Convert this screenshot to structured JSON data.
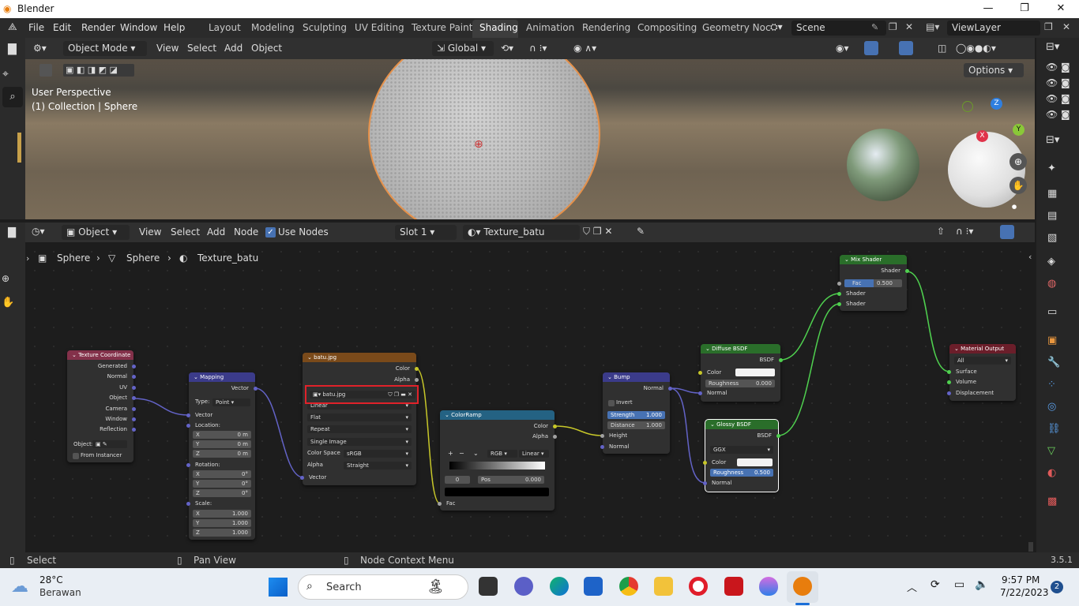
{
  "window": {
    "title": "Blender",
    "min": "—",
    "max": "❐",
    "close": "✕"
  },
  "menu": {
    "items": [
      "File",
      "Edit",
      "Render",
      "Window",
      "Help"
    ]
  },
  "workspaces": [
    "Layout",
    "Modeling",
    "Sculpting",
    "UV Editing",
    "Texture Paint",
    "Shading",
    "Animation",
    "Rendering",
    "Compositing",
    "Geometry Noc"
  ],
  "active_workspace": "Shading",
  "scene": {
    "name": "Scene",
    "view_layer": "ViewLayer"
  },
  "viewport_header": {
    "mode": "Object Mode",
    "view": "View",
    "select": "Select",
    "add": "Add",
    "object": "Object",
    "orientation": "Global",
    "options": "Options"
  },
  "viewport": {
    "perspective": "User Perspective",
    "collection": "(1) Collection | Sphere",
    "gizmo_x": "X",
    "gizmo_y": "Y",
    "gizmo_z": "Z"
  },
  "node_header": {
    "editor_type": "Object",
    "view": "View",
    "select": "Select",
    "add": "Add",
    "node": "Node",
    "use_nodes": "Use Nodes",
    "slot": "Slot 1",
    "material": "Texture_batu"
  },
  "breadcrumb": {
    "object": "Sphere",
    "mesh": "Sphere",
    "material": "Texture_batu"
  },
  "nodes": {
    "texcoord": {
      "title": "Texture Coordinate",
      "outputs": [
        "Generated",
        "Normal",
        "UV",
        "Object",
        "Camera",
        "Window",
        "Reflection"
      ],
      "object_label": "Object:",
      "from_instancer": "From Instancer"
    },
    "mapping": {
      "title": "Mapping",
      "vector_out": "Vector",
      "type_label": "Type:",
      "type_value": "Point",
      "vector_in": "Vector",
      "location": "Location:",
      "rotation": "Rotation:",
      "scale": "Scale:",
      "loc": [
        {
          "axis": "X",
          "value": "0 m"
        },
        {
          "axis": "Y",
          "value": "0 m"
        },
        {
          "axis": "Z",
          "value": "0 m"
        }
      ],
      "rot": [
        {
          "axis": "X",
          "value": "0°"
        },
        {
          "axis": "Y",
          "value": "0°"
        },
        {
          "axis": "Z",
          "value": "0°"
        }
      ],
      "scl": [
        {
          "axis": "X",
          "value": "1.000"
        },
        {
          "axis": "Y",
          "value": "1.000"
        },
        {
          "axis": "Z",
          "value": "1.000"
        }
      ]
    },
    "image": {
      "title": "batu.jpg",
      "color": "Color",
      "alpha": "Alpha",
      "image_name": "batu.jpg",
      "interp": "Linear",
      "proj": "Flat",
      "ext": "Repeat",
      "source": "Single Image",
      "cs_label": "Color Space",
      "cs_value": "sRGB",
      "alpha_label": "Alpha",
      "alpha_value": "Straight",
      "vector": "Vector"
    },
    "colorramp": {
      "title": "ColorRamp",
      "color": "Color",
      "alpha": "Alpha",
      "mode": "RGB",
      "interp": "Linear",
      "index": "0",
      "pos_label": "Pos",
      "pos_value": "0.000",
      "fac": "Fac",
      "plus": "+",
      "minus": "−"
    },
    "bump": {
      "title": "Bump",
      "normal_out": "Normal",
      "invert": "Invert",
      "strength_label": "Strength",
      "strength": "1.000",
      "distance_label": "Distance",
      "distance": "1.000",
      "height": "Height",
      "normal_in": "Normal"
    },
    "diffuse": {
      "title": "Diffuse BSDF",
      "bsdf": "BSDF",
      "color": "Color",
      "roughness_label": "Roughness",
      "roughness": "0.000",
      "normal": "Normal"
    },
    "glossy": {
      "title": "Glossy BSDF",
      "bsdf": "BSDF",
      "dist": "GGX",
      "color": "Color",
      "roughness_label": "Roughness",
      "roughness": "0.500",
      "normal": "Normal"
    },
    "mix": {
      "title": "Mix Shader",
      "shader_out": "Shader",
      "fac_label": "Fac",
      "fac": "0.500",
      "shader1": "Shader",
      "shader2": "Shader"
    },
    "output": {
      "title": "Material Output",
      "target": "All",
      "surface": "Surface",
      "volume": "Volume",
      "displacement": "Displacement"
    }
  },
  "status": {
    "select": "Select",
    "pan": "Pan View",
    "context": "Node Context Menu",
    "version": "3.5.1"
  },
  "taskbar": {
    "temp": "28°C",
    "weather": "Berawan",
    "search": "Search",
    "time": "9:57 PM",
    "date": "7/22/2023",
    "badge": "2"
  },
  "colors": {
    "accent": "#4772b3",
    "selection": "#e6914a",
    "highlight_box": "#e0222a"
  }
}
